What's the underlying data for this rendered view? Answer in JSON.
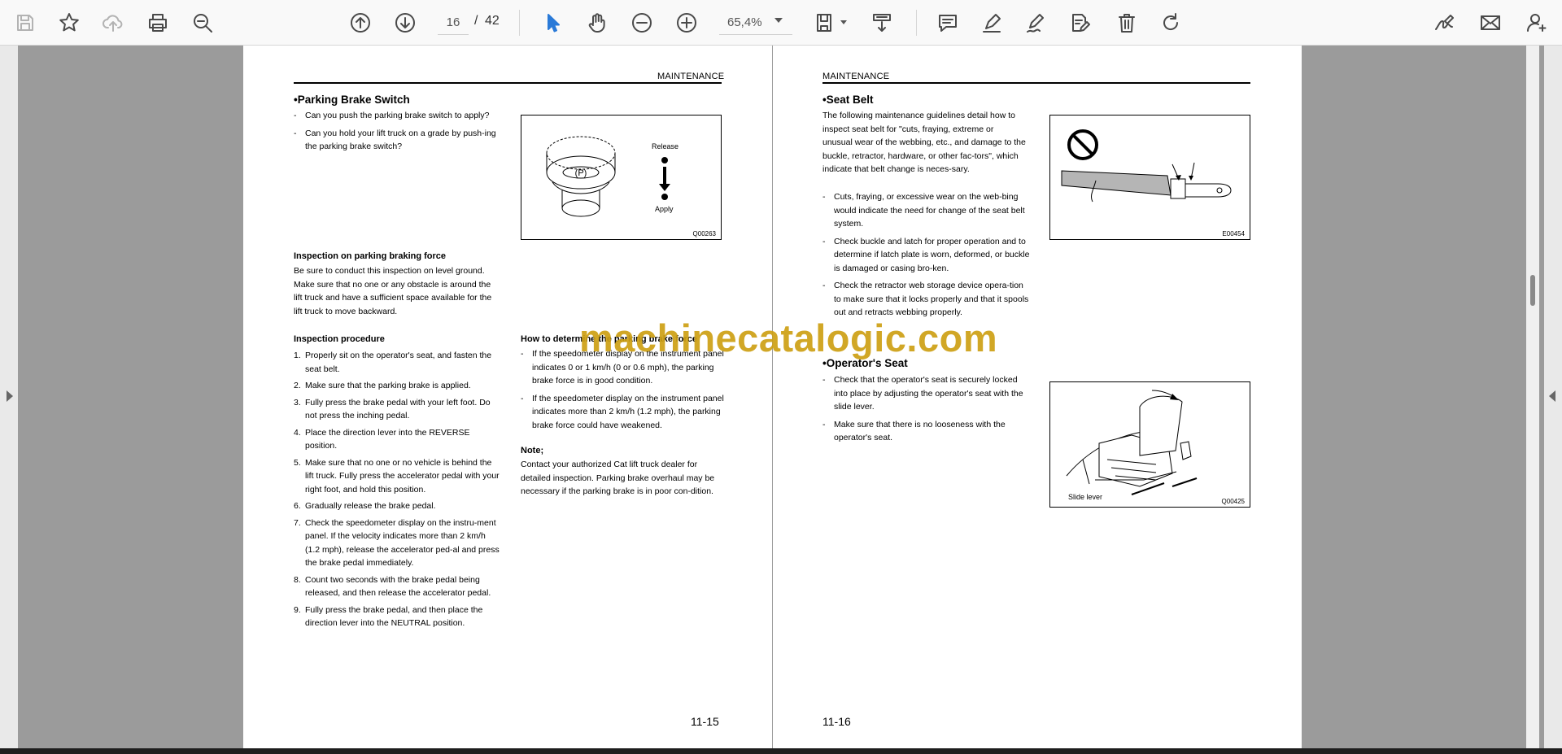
{
  "toolbar": {
    "page_current": "16",
    "page_separator": "/",
    "page_total": "42",
    "zoom": "65,4%"
  },
  "icons": {
    "save": "save-icon",
    "bookmark": "star-icon",
    "upload": "cloud-upload-icon",
    "print": "print-icon",
    "find": "zoom-find-icon",
    "prev_page": "arrow-up-circle-icon",
    "next_page": "arrow-down-circle-icon",
    "select": "cursor-icon",
    "hand": "hand-icon",
    "zoom_out": "zoom-out-icon",
    "zoom_in": "zoom-in-icon",
    "page_fit": "page-fit-icon",
    "scroll_mode": "scroll-mode-icon",
    "comment": "comment-icon",
    "highlight": "pen-icon",
    "draw": "draw-icon",
    "edit_text": "edit-text-icon",
    "delete": "trash-icon",
    "rotate": "rotate-icon",
    "sign": "sign-icon",
    "email": "mail-icon",
    "add_user": "add-user-icon"
  },
  "colors": {
    "accent": "#2a7ad8",
    "watermark": "#cda014"
  },
  "left_page": {
    "running_head": "MAINTENANCE",
    "section_title": "•Parking Brake Switch",
    "intro_items": [
      "Can you push the parking brake switch to apply?",
      "Can you hold your lift truck on a grade by push-ing the parking brake switch?"
    ],
    "figure": {
      "release": "Release",
      "apply": "Apply",
      "code": "Q00263",
      "symbol": "(P)"
    },
    "inspection_force": {
      "title": "Inspection on parking braking force",
      "text": "Be sure to conduct this inspection on level ground. Make sure that no one or any obstacle is around the lift truck and have a sufficient space available for the lift truck to move backward."
    },
    "procedure": {
      "title": "Inspection procedure",
      "steps": [
        "Properly sit on the operator's seat, and fasten the seat belt.",
        "Make sure that the parking brake is applied.",
        "Fully press the brake pedal with your left foot. Do not press the inching pedal.",
        "Place the direction lever into the REVERSE position.",
        "Make sure that no one or no vehicle is behind the lift truck. Fully press the accelerator pedal with your right foot, and hold this position.",
        "Gradually release the brake pedal.",
        "Check the speedometer display on the instru-ment panel. If the velocity indicates more than 2 km/h (1.2 mph), release the accelerator ped-al and press the brake pedal immediately.",
        "Count two seconds with the brake pedal being released, and then release the accelerator pedal.",
        "Fully press the brake pedal, and then place the direction lever into the NEUTRAL position."
      ]
    },
    "determine": {
      "title": "How to determine the parking brake force",
      "items": [
        "If the speedometer display on the instrument panel indicates 0 or 1 km/h (0 or 0.6 mph), the parking brake force is in good condition.",
        "If the speedometer display on the instrument panel indicates more than 2 km/h (1.2 mph), the parking brake force could have weakened."
      ],
      "note_title": "Note;",
      "note_text": "Contact your authorized Cat lift truck dealer for detailed inspection. Parking brake overhaul may be necessary if the parking brake is in poor con-dition."
    },
    "page_number": "11-15"
  },
  "right_page": {
    "running_head": "MAINTENANCE",
    "seat_belt": {
      "title": "•Seat Belt",
      "intro": "The following maintenance guidelines detail how to inspect seat belt for \"cuts, fraying, extreme or unusual wear of the webbing, etc., and damage to the buckle, retractor, hardware, or other fac-tors\", which indicate that belt change is neces-sary.",
      "items": [
        "Cuts, fraying, or excessive wear on the web-bing would indicate the need for change of the seat belt system.",
        "Check buckle and latch for proper operation and to determine if latch plate is worn, deformed, or buckle is damaged or casing bro-ken.",
        "Check the retractor web storage device opera-tion to make sure that it locks properly and that it spools out and retracts webbing properly."
      ],
      "figure_code": "E00454"
    },
    "operator_seat": {
      "title": "•Operator's Seat",
      "items": [
        "Check that the operator's seat is securely locked into place by adjusting the operator's seat with the slide lever.",
        "Make sure that there is no looseness with the operator's seat."
      ],
      "figure_label": "Slide lever",
      "figure_code": "Q00425"
    },
    "page_number": "11-16"
  },
  "watermark": "machinecatalogic.com"
}
